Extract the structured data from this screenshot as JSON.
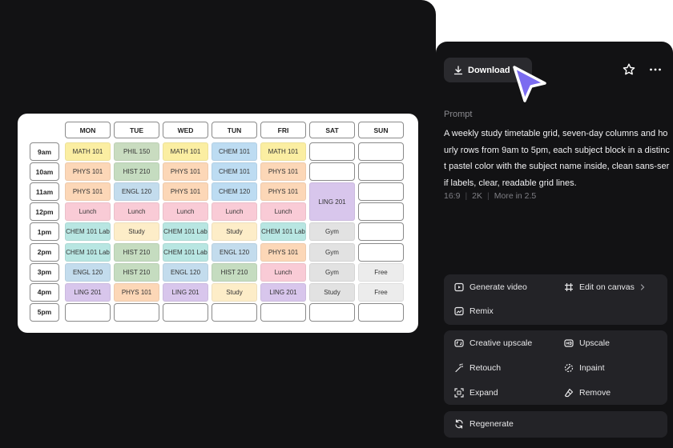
{
  "timetable": {
    "days": [
      "MON",
      "TUE",
      "WED",
      "TUN",
      "FRI",
      "SAT",
      "SUN"
    ],
    "times": [
      "9am",
      "10am",
      "11am",
      "12pm",
      "1pm",
      "2pm",
      "3pm",
      "4pm",
      "5pm"
    ],
    "colors": {
      "MATH": "#fbeea2",
      "PHIL": "#c9dcc0",
      "CHEM": "#bddcf2",
      "PHYS": "#fcd7b7",
      "HIST": "#c5dcc0",
      "ENGL": "#c3dced",
      "LUNCH": "#f9cbd6",
      "LAB": "#b8e6e2",
      "STUDY": "#fdedc8",
      "LING": "#d8c6ec",
      "GYM": "#e2e2e2",
      "FREE": "#ececec"
    },
    "blocks": [
      {
        "day": 0,
        "row": 0,
        "span": 1,
        "label": "MATH 101",
        "color": "MATH"
      },
      {
        "day": 1,
        "row": 0,
        "span": 1,
        "label": "PHIL 150",
        "color": "PHIL"
      },
      {
        "day": 2,
        "row": 0,
        "span": 1,
        "label": "MATH 101",
        "color": "MATH"
      },
      {
        "day": 3,
        "row": 0,
        "span": 1,
        "label": "CHEM 101",
        "color": "CHEM"
      },
      {
        "day": 4,
        "row": 0,
        "span": 1,
        "label": "MATH 101",
        "color": "MATH"
      },
      {
        "day": 0,
        "row": 1,
        "span": 1,
        "label": "PHYS 101",
        "color": "PHYS"
      },
      {
        "day": 1,
        "row": 1,
        "span": 1,
        "label": "HIST 210",
        "color": "HIST"
      },
      {
        "day": 2,
        "row": 1,
        "span": 1,
        "label": "PHYS 101",
        "color": "PHYS"
      },
      {
        "day": 3,
        "row": 1,
        "span": 1,
        "label": "CHEM 101",
        "color": "CHEM"
      },
      {
        "day": 4,
        "row": 1,
        "span": 1,
        "label": "PHYS 101",
        "color": "PHYS"
      },
      {
        "day": 0,
        "row": 2,
        "span": 1,
        "label": "PHYS 101",
        "color": "PHYS"
      },
      {
        "day": 1,
        "row": 2,
        "span": 1,
        "label": "ENGL 120",
        "color": "ENGL"
      },
      {
        "day": 2,
        "row": 2,
        "span": 1,
        "label": "PHYS 101",
        "color": "PHYS"
      },
      {
        "day": 3,
        "row": 2,
        "span": 1,
        "label": "CHEM 120",
        "color": "CHEM"
      },
      {
        "day": 4,
        "row": 2,
        "span": 1,
        "label": "PHYS 101",
        "color": "PHYS"
      },
      {
        "day": 5,
        "row": 2,
        "span": 2,
        "label": "LING 201",
        "color": "LING"
      },
      {
        "day": 0,
        "row": 3,
        "span": 1,
        "label": "Lunch",
        "color": "LUNCH"
      },
      {
        "day": 1,
        "row": 3,
        "span": 1,
        "label": "Lunch",
        "color": "LUNCH"
      },
      {
        "day": 2,
        "row": 3,
        "span": 1,
        "label": "Lunch",
        "color": "LUNCH"
      },
      {
        "day": 3,
        "row": 3,
        "span": 1,
        "label": "Lunch",
        "color": "LUNCH"
      },
      {
        "day": 4,
        "row": 3,
        "span": 1,
        "label": "Lunch",
        "color": "LUNCH"
      },
      {
        "day": 0,
        "row": 4,
        "span": 1,
        "label": "CHEM 101 Lab",
        "color": "LAB"
      },
      {
        "day": 1,
        "row": 4,
        "span": 1,
        "label": "Study",
        "color": "STUDY"
      },
      {
        "day": 2,
        "row": 4,
        "span": 1,
        "label": "CHEM 101 Lab",
        "color": "LAB"
      },
      {
        "day": 3,
        "row": 4,
        "span": 1,
        "label": "Study",
        "color": "STUDY"
      },
      {
        "day": 4,
        "row": 4,
        "span": 1,
        "label": "CHEM 101 Lab",
        "color": "LAB"
      },
      {
        "day": 5,
        "row": 4,
        "span": 1,
        "label": "Gym",
        "color": "GYM"
      },
      {
        "day": 0,
        "row": 5,
        "span": 1,
        "label": "CHEM 101 Lab",
        "color": "LAB"
      },
      {
        "day": 1,
        "row": 5,
        "span": 1,
        "label": "HIST 210",
        "color": "HIST"
      },
      {
        "day": 2,
        "row": 5,
        "span": 1,
        "label": "CHEM 101 Lab",
        "color": "LAB"
      },
      {
        "day": 3,
        "row": 5,
        "span": 1,
        "label": "ENGL 120",
        "color": "ENGL"
      },
      {
        "day": 4,
        "row": 5,
        "span": 1,
        "label": "PHYS 101",
        "color": "PHYS"
      },
      {
        "day": 5,
        "row": 5,
        "span": 1,
        "label": "Gym",
        "color": "GYM"
      },
      {
        "day": 0,
        "row": 6,
        "span": 1,
        "label": "ENGL 120",
        "color": "ENGL"
      },
      {
        "day": 1,
        "row": 6,
        "span": 1,
        "label": "HIST 210",
        "color": "HIST"
      },
      {
        "day": 2,
        "row": 6,
        "span": 1,
        "label": "ENGL 120",
        "color": "ENGL"
      },
      {
        "day": 3,
        "row": 6,
        "span": 1,
        "label": "HIST 210",
        "color": "HIST"
      },
      {
        "day": 4,
        "row": 6,
        "span": 1,
        "label": "Lunch",
        "color": "LUNCH"
      },
      {
        "day": 5,
        "row": 6,
        "span": 1,
        "label": "Gym",
        "color": "GYM"
      },
      {
        "day": 6,
        "row": 6,
        "span": 1,
        "label": "Free",
        "color": "FREE"
      },
      {
        "day": 0,
        "row": 7,
        "span": 1,
        "label": "LING 201",
        "color": "LING"
      },
      {
        "day": 1,
        "row": 7,
        "span": 1,
        "label": "PHYS 101",
        "color": "PHYS"
      },
      {
        "day": 2,
        "row": 7,
        "span": 1,
        "label": "LING 201",
        "color": "LING"
      },
      {
        "day": 3,
        "row": 7,
        "span": 1,
        "label": "Study",
        "color": "STUDY"
      },
      {
        "day": 4,
        "row": 7,
        "span": 1,
        "label": "LING 201",
        "color": "LING"
      },
      {
        "day": 5,
        "row": 7,
        "span": 1,
        "label": "Study",
        "color": "GYM"
      },
      {
        "day": 6,
        "row": 7,
        "span": 1,
        "label": "Free",
        "color": "FREE"
      }
    ]
  },
  "panel": {
    "download_label": "Download",
    "prompt_label": "Prompt",
    "prompt_text": "A weekly study timetable grid, seven-day columns and hourly rows from 9am to 5pm, each subject block in a distinct pastel color with the subject name inside, clean sans-serif labels, clear, readable grid lines.",
    "meta_ratio": "16:9",
    "meta_res": "2K",
    "meta_more": "More in 2.5"
  },
  "actions": {
    "generate_video": "Generate video",
    "edit_on_canvas": "Edit on canvas",
    "remix": "Remix",
    "creative_upscale": "Creative upscale",
    "upscale": "Upscale",
    "retouch": "Retouch",
    "inpaint": "Inpaint",
    "expand": "Expand",
    "remove": "Remove",
    "regenerate": "Regenerate"
  }
}
